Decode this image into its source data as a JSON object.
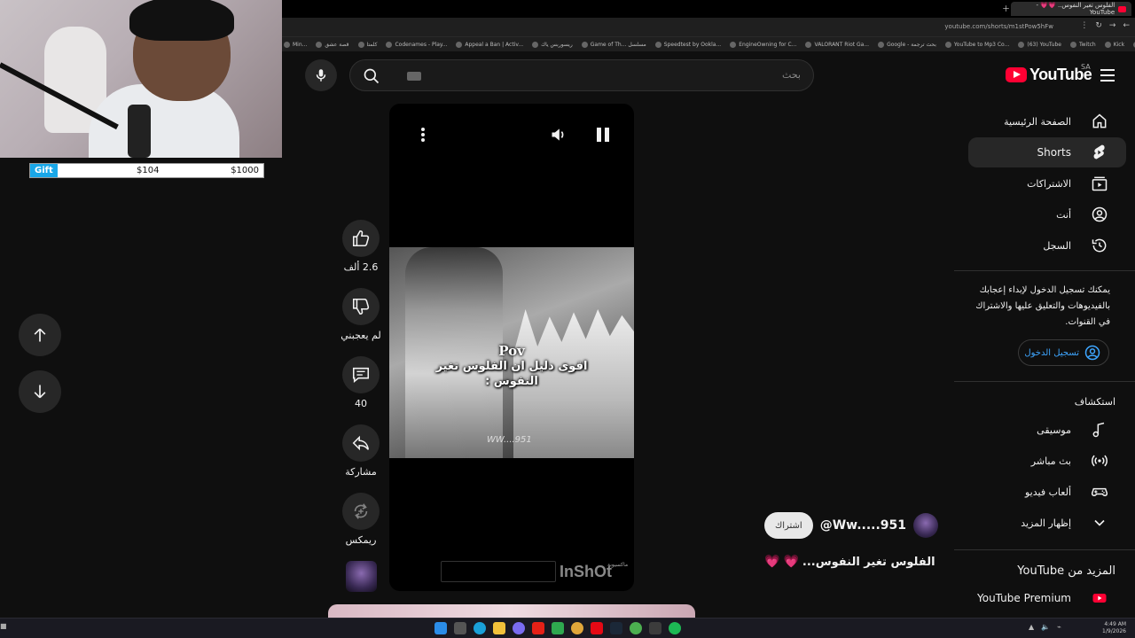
{
  "browser": {
    "tab_title": "الفلوس تغير النفوس.. 💗💗 - YouTube",
    "url": "youtube.com/shorts/m1stPow5hFw",
    "bookmarks": [
      "Min...",
      "قصة عشق",
      "كلمتا",
      "Codenames - Play...",
      "Appeal a Ban | Activ...",
      "ريسوربس ياك",
      "Game of Th... مسلسل",
      "Speedtest by Ookla...",
      "EngineOwning for C...",
      "VALORANT Riot Ga...",
      "Google - بحث ترجمة",
      "YouTube to Mp3 Co...",
      "(63) YouTube",
      "Twitch",
      "Kick",
      "Warcraft"
    ]
  },
  "gift": {
    "label": "Gift",
    "current": "$104",
    "goal": "$1000",
    "progress_fraction": 0.104
  },
  "search": {
    "placeholder": "بحث"
  },
  "logo": {
    "text": "YouTube",
    "region": "SA"
  },
  "sidebar": {
    "items": [
      {
        "label": "الصفحة الرئيسية",
        "icon": "home-icon"
      },
      {
        "label": "Shorts",
        "icon": "shorts-icon",
        "active": true
      },
      {
        "label": "الاشتراكات",
        "icon": "subscriptions-icon"
      },
      {
        "label": "أنت",
        "icon": "you-icon"
      },
      {
        "label": "السجل",
        "icon": "history-icon"
      }
    ],
    "signin_prompt": "يمكنك تسجيل الدخول لإبداء إعجابك بالفيديوهات والتعليق عليها والاشتراك في القنوات.",
    "signin_label": "تسجيل الدخول",
    "explore_title": "استكشاف",
    "explore": [
      {
        "label": "موسيقى",
        "icon": "music-icon"
      },
      {
        "label": "بث مباشر",
        "icon": "live-icon"
      },
      {
        "label": "ألعاب فيديو",
        "icon": "gaming-icon"
      },
      {
        "label": "إظهار المزيد",
        "icon": "chevron-down-icon"
      }
    ],
    "more_title": "المزيد من YouTube",
    "premium_label": "YouTube Premium"
  },
  "video": {
    "pov": "Pov",
    "caption": "اقوى دليل ان الفلوس تغير النفوس :",
    "watermark": "WW....951",
    "inshot": "InShOt",
    "inshot_small": "ماكسيوبة"
  },
  "actions": {
    "likes": "2.6 ألف",
    "dislike": "لم يعجبني",
    "comments": "40",
    "share": "مشاركة",
    "remix": "ريمكس"
  },
  "channel": {
    "name": "@Ww.....951",
    "subscribe": "اشتراك"
  },
  "video_title": "الفلوس تغير النفوس...",
  "tray": {
    "time": "4:49 AM",
    "date": "1/9/2026"
  },
  "colors": {
    "accent": "#ff0033",
    "link": "#3ea6ff",
    "gift": "#19a7e8"
  }
}
